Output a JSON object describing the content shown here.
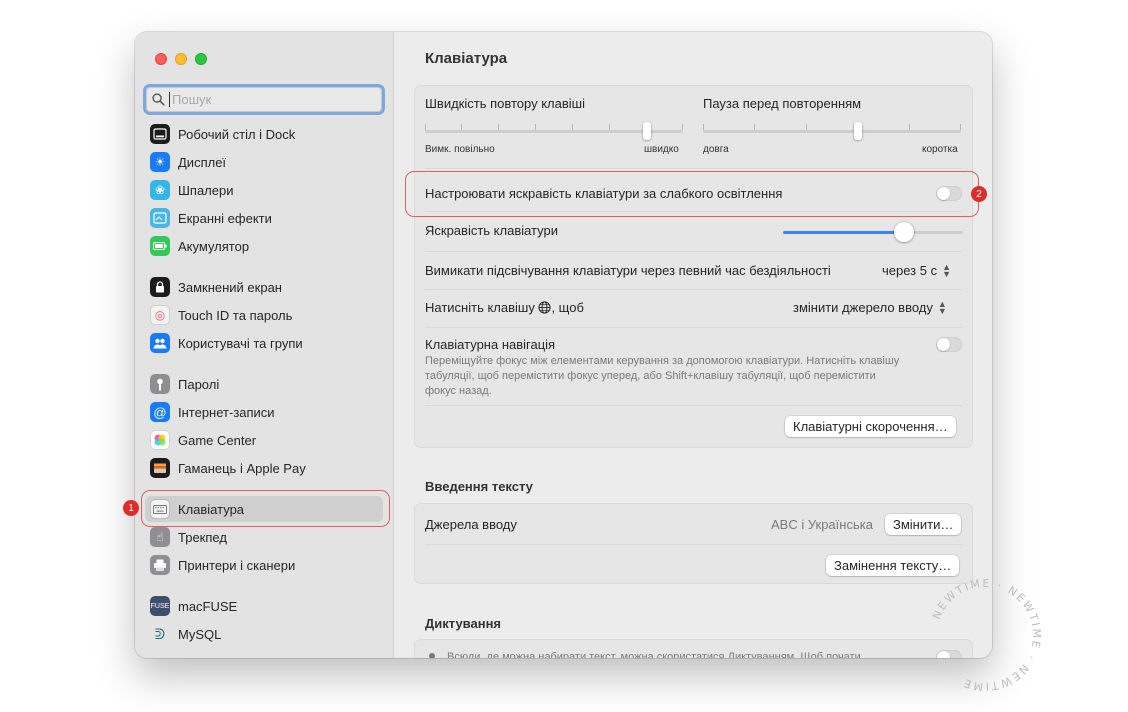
{
  "sidebar": {
    "search_placeholder": "Пошук",
    "items": [
      {
        "label": "Робочий стіл і Dock",
        "icon": "dock-icon"
      },
      {
        "label": "Дисплеї",
        "icon": "display-icon"
      },
      {
        "label": "Шпалери",
        "icon": "wallpaper-icon"
      },
      {
        "label": "Екранні ефекти",
        "icon": "screensaver-icon"
      },
      {
        "label": "Акумулятор",
        "icon": "battery-icon"
      },
      {
        "label": "Замкнений екран",
        "icon": "lock-icon"
      },
      {
        "label": "Touch ID та пароль",
        "icon": "fingerprint-icon"
      },
      {
        "label": "Користувачі та групи",
        "icon": "users-icon"
      },
      {
        "label": "Паролі",
        "icon": "key-icon"
      },
      {
        "label": "Інтернет-записи",
        "icon": "at-icon"
      },
      {
        "label": "Game Center",
        "icon": "game-center-icon"
      },
      {
        "label": "Гаманець і Apple Pay",
        "icon": "wallet-icon"
      },
      {
        "label": "Клавіатура",
        "icon": "keyboard-icon"
      },
      {
        "label": "Трекпед",
        "icon": "trackpad-icon"
      },
      {
        "label": "Принтери і сканери",
        "icon": "printer-icon"
      },
      {
        "label": "macFUSE",
        "icon": "macfuse-icon"
      },
      {
        "label": "MySQL",
        "icon": "mysql-icon"
      }
    ]
  },
  "main": {
    "title": "Клавіатура",
    "key_repeat": {
      "label": "Швидкість повтору клавіші",
      "min_label": "Вимк.",
      "slow_label": "повільно",
      "max_label": "швидко",
      "value_fraction": 0.86
    },
    "delay_repeat": {
      "label": "Пауза перед повторенням",
      "min_label": "довга",
      "max_label": "коротка",
      "value_fraction": 0.6
    },
    "adjust_brightness": {
      "label": "Настроювати яскравість клавіатури за слабкого освітлення",
      "on": false
    },
    "brightness": {
      "label": "Яскравість клавіатури",
      "value_fraction": 0.67
    },
    "backlight_off": {
      "label": "Вимикати підсвічування клавіатури через певний час бездіяльності",
      "value": "через 5 с"
    },
    "globe_key": {
      "label_before": "Натисніть клавішу",
      "label_after": ", щоб",
      "value": "змінити джерело вводу"
    },
    "keyboard_nav": {
      "label": "Клавіатурна навігація",
      "description": "Переміщуйте фокус між елементами керування за допомогою клавіатури. Натисніть клавішу табуляції, щоб перемістити фокус уперед, або Shift+клавішу табуляції, щоб перемістити фокус назад.",
      "on": false
    },
    "shortcuts_button": "Клавіатурні скорочення…",
    "text_input": {
      "section_title": "Введення тексту",
      "sources_label": "Джерела вводу",
      "sources_value": "ABC і Українська",
      "change_button": "Змінити…",
      "replace_button": "Замінення тексту…"
    },
    "dictation": {
      "section_title": "Диктування",
      "description_partial": "Всюди, де можна набирати текст, можна скористатися Диктуванням. Щоб почати"
    }
  },
  "annotations": {
    "badge1": "1",
    "badge2": "2",
    "color": "#e02b2b"
  },
  "watermark": {
    "text": "NEWTIME"
  }
}
